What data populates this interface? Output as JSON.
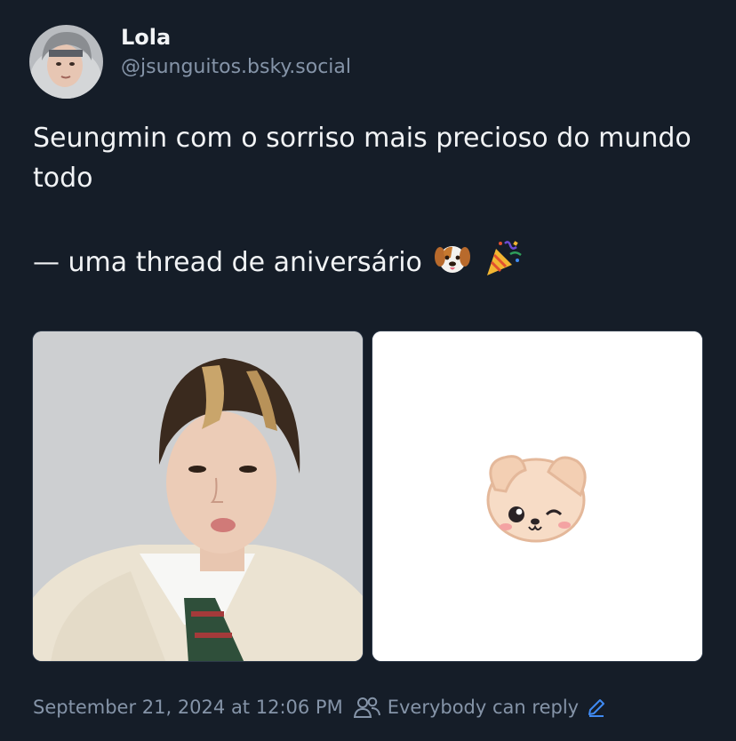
{
  "author": {
    "display_name": "Lola",
    "handle": "@jsunguitos.bsky.social"
  },
  "post": {
    "line1": "Seungmin com o sorriso mais precioso do mundo todo",
    "line2": "— uma thread de aniversário",
    "emojis": [
      "dog-face-emoji",
      "party-popper-emoji"
    ],
    "images": [
      {
        "name": "photo-boy-hoodie"
      },
      {
        "name": "sticker-puppy-wink"
      }
    ]
  },
  "meta": {
    "timestamp": "September 21, 2024 at 12:06 PM",
    "reply_settings": "Everybody can reply"
  },
  "colors": {
    "background": "#151d28",
    "text": "#f1f3f5",
    "muted": "#8594a8",
    "accent": "#3f8af2"
  }
}
